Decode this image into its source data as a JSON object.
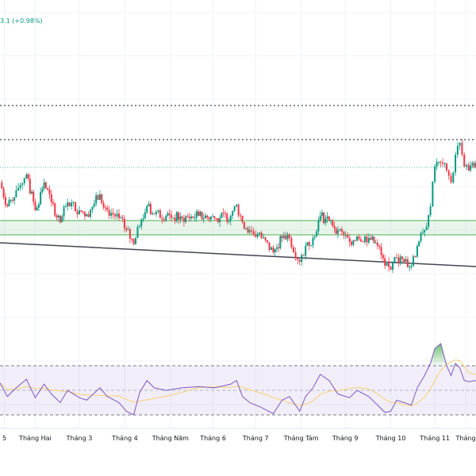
{
  "header": {
    "price_change": "3.1 (+0.98%)"
  },
  "colors": {
    "up": "#089981",
    "down": "#f23645",
    "rsi": "#7e57c2",
    "rsi_ma": "#f5d58a",
    "zone": "#4caf50",
    "trend": "#434651",
    "level": "#131722"
  },
  "chart_data": [
    {
      "type": "candlestick",
      "title": "",
      "xlabel": "",
      "ylabel": "",
      "xlim": [
        0,
        324
      ],
      "ylim": [
        0,
        340
      ],
      "grid": true,
      "x_ticks": [
        {
          "t": 3,
          "label": "5"
        },
        {
          "t": 24,
          "label": "Tháng Hai"
        },
        {
          "t": 54,
          "label": "Tháng 3"
        },
        {
          "t": 85,
          "label": "Tháng 4"
        },
        {
          "t": 116,
          "label": "Tháng Năm"
        },
        {
          "t": 145,
          "label": "Tháng 6"
        },
        {
          "t": 174,
          "label": "Tháng 7"
        },
        {
          "t": 205,
          "label": "Tháng Tám"
        },
        {
          "t": 235,
          "label": "Tháng 9"
        },
        {
          "t": 266,
          "label": "Tháng 10"
        },
        {
          "t": 296,
          "label": "Tháng 11"
        },
        {
          "t": 317,
          "label": "Tháng"
        }
      ],
      "t": [
        0,
        5,
        11,
        18,
        24,
        30,
        35,
        41,
        46,
        54,
        59,
        68,
        73,
        81,
        86,
        91,
        95,
        100,
        105,
        113,
        124,
        135,
        146,
        157,
        161,
        165,
        170,
        178,
        186,
        192,
        197,
        204,
        208,
        213,
        218,
        224,
        230,
        238,
        243,
        251,
        257,
        262,
        266,
        270,
        275,
        280,
        284,
        289,
        293,
        296,
        300,
        304,
        307,
        310,
        313,
        316,
        319,
        324
      ],
      "close": [
        170,
        140,
        160,
        180,
        135,
        170,
        145,
        120,
        145,
        135,
        130,
        155,
        135,
        125,
        110,
        92,
        115,
        140,
        130,
        128,
        125,
        128,
        125,
        128,
        142,
        120,
        110,
        100,
        82,
        100,
        100,
        70,
        90,
        100,
        128,
        122,
        110,
        95,
        102,
        100,
        90,
        65,
        60,
        75,
        70,
        65,
        90,
        110,
        140,
        190,
        195,
        185,
        170,
        205,
        220,
        190,
        185,
        195
      ],
      "levels": {
        "resistance_dotted_upper": 267,
        "resistance_dotted": 224,
        "level_thin": 189
      },
      "zone": [
        104,
        122
      ],
      "trendline": {
        "start": [
          0,
          94
        ],
        "end": [
          324,
          64
        ]
      }
    },
    {
      "type": "line",
      "title": "RSI",
      "ylim": [
        0,
        100
      ],
      "bands": [
        30,
        50,
        70
      ],
      "ma_period": 6,
      "values": [
        56,
        45,
        52,
        59,
        44,
        55,
        47,
        40,
        50,
        44,
        42,
        52,
        45,
        40,
        33,
        30,
        48,
        58,
        52,
        50,
        52,
        53,
        52,
        55,
        58,
        45,
        40,
        36,
        31,
        42,
        45,
        33,
        45,
        52,
        63,
        58,
        47,
        44,
        50,
        45,
        38,
        32,
        33,
        42,
        40,
        38,
        52,
        62,
        72,
        84,
        88,
        70,
        62,
        72,
        68,
        58,
        57,
        58
      ]
    }
  ]
}
